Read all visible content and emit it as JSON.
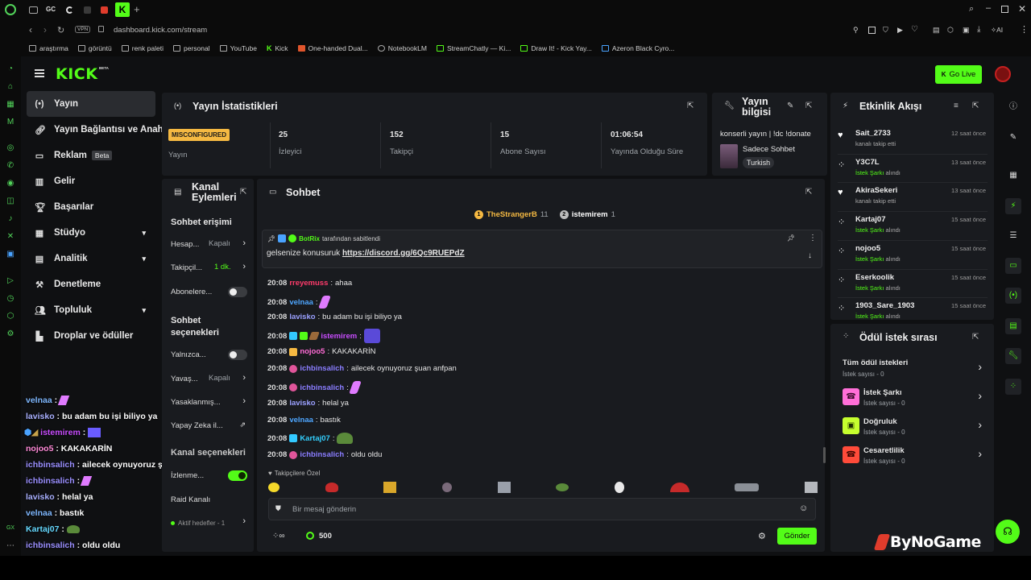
{
  "browser": {
    "tabs": [
      "GC"
    ],
    "url": "dashboard.kick.com/stream",
    "vpn": "VPN",
    "ai_label": "AI",
    "bookmarks": [
      "araştırma",
      "görüntü",
      "renk paleti",
      "personal",
      "YouTube",
      "Kick",
      "One-handed Dual...",
      "NotebookLM",
      "StreamChatly — Ki...",
      "Draw It! - Kick Yay...",
      "Azeron Black Cyro..."
    ]
  },
  "brand": {
    "logo": "KICK",
    "beta": "BETA",
    "accent": "#53fc18"
  },
  "header": {
    "go_live": "Go Live"
  },
  "sidebar": {
    "items": [
      {
        "label": "Yayın",
        "icon": "broadcast-icon"
      },
      {
        "label": "Yayın Bağlantısı ve Anahtar",
        "icon": "link-icon"
      },
      {
        "label": "Reklam",
        "badge": "Beta",
        "icon": "ad-icon"
      },
      {
        "label": "Gelir",
        "icon": "revenue-icon"
      },
      {
        "label": "Başarılar",
        "icon": "trophy-icon"
      },
      {
        "label": "Stüdyo",
        "icon": "studio-icon"
      },
      {
        "label": "Analitik",
        "icon": "chart-icon"
      },
      {
        "label": "Denetleme",
        "icon": "hammer-icon"
      },
      {
        "label": "Topluluk",
        "icon": "community-icon"
      },
      {
        "label": "Droplar ve ödüller",
        "icon": "drops-icon"
      }
    ]
  },
  "stats": {
    "title": "Yayın İstatistikleri",
    "status_badge": "MISCONFIGURED",
    "status_label": "Yayın",
    "cells": [
      {
        "value": "25",
        "label": "İzleyici"
      },
      {
        "value": "152",
        "label": "Takipçi"
      },
      {
        "value": "15",
        "label": "Abone Sayısı"
      },
      {
        "value": "01:06:54",
        "label": "Yayında Olduğu Süre"
      }
    ]
  },
  "stream_info": {
    "title": "Yayın bilgisi",
    "stream_title": "konserli yayın | !dc !donate",
    "category": "Sadece Sohbet",
    "language": "Turkish"
  },
  "channel_actions": {
    "title": "Kanal Eylemleri",
    "chat_access": "Sohbet erişimi",
    "rows1": [
      {
        "label": "Hesap...",
        "value": "Kapalı"
      },
      {
        "label": "Takipçil...",
        "value": "1 dk."
      },
      {
        "label": "Abonelere...",
        "value": ""
      }
    ],
    "chat_options": "Sohbet seçenekleri",
    "rows2": [
      {
        "label": "Yalnızca...",
        "value": ""
      },
      {
        "label": "Yavaş...",
        "value": "Kapalı"
      },
      {
        "label": "Yasaklanmış...",
        "value": ""
      },
      {
        "label": "Yapay Zeka il...",
        "value": ""
      }
    ],
    "channel_options": "Kanal seçenekleri",
    "rows3": [
      {
        "label": "İzlenme...",
        "value": ""
      },
      {
        "label": "Raid Kanalı",
        "value": ""
      },
      {
        "label": "Aktif hedefler - 1",
        "value": ""
      }
    ]
  },
  "chat": {
    "title": "Sohbet",
    "top_gifters": [
      {
        "name": "TheStrangerB",
        "count": "11"
      },
      {
        "name": "istemirem",
        "count": "1"
      }
    ],
    "pinned_by": "BotRix",
    "pinned_suffix": "tarafından sabitlendi",
    "pinned_text": "gelsenize konusuruk",
    "pinned_link": "https://discord.gg/6Qc9RUEPdZ",
    "messages": [
      {
        "time": "20:08",
        "user": "rreyemuss",
        "color": "#ff3b6b",
        "text": "ahaa"
      },
      {
        "time": "20:08",
        "user": "velnaa",
        "color": "#4ea6ff",
        "text": ""
      },
      {
        "time": "20:08",
        "user": "lavisko",
        "color": "#9aa0ff",
        "text": "bu adam bu işi biliyo ya"
      },
      {
        "time": "20:08",
        "user": "istemirem",
        "color": "#c94dff",
        "text": ""
      },
      {
        "time": "20:08",
        "user": "nojoo5",
        "color": "#ff6bd6",
        "text": "KAKAKARİN"
      },
      {
        "time": "20:08",
        "user": "ichbinsalich",
        "color": "#8a7dff",
        "text": "ailecek oynuyoruz şuan anfpan"
      },
      {
        "time": "20:08",
        "user": "ichbinsalich",
        "color": "#8a7dff",
        "text": ""
      },
      {
        "time": "20:08",
        "user": "lavisko",
        "color": "#9aa0ff",
        "text": "helal ya"
      },
      {
        "time": "20:08",
        "user": "velnaa",
        "color": "#4ea6ff",
        "text": "bastık"
      },
      {
        "time": "20:08",
        "user": "Kartaj07",
        "color": "#33d0ff",
        "text": ""
      },
      {
        "time": "20:08",
        "user": "ichbinsalich",
        "color": "#8a7dff",
        "text": "oldu oldu"
      }
    ],
    "followers_only": "Takipçilere Özel",
    "placeholder": "Bir mesaj gönderin",
    "points": "500",
    "send": "Gönder"
  },
  "activity": {
    "title": "Etkinlik Akışı",
    "events": [
      {
        "name": "Sait_2733",
        "sub": "kanalı takip etti",
        "time": "12 saat önce",
        "kind": "follow"
      },
      {
        "name": "Y3C7L",
        "sub": "İstek Şarkı alındı",
        "time": "13 saat önce",
        "kind": "reward"
      },
      {
        "name": "AkiraSekeri",
        "sub": "kanalı takip etti",
        "time": "13 saat önce",
        "kind": "follow"
      },
      {
        "name": "Kartaj07",
        "sub": "İstek Şarkı alındı",
        "time": "15 saat önce",
        "kind": "reward"
      },
      {
        "name": "nojoo5",
        "sub": "İstek Şarkı alındı",
        "time": "15 saat önce",
        "kind": "reward"
      },
      {
        "name": "Eserkoolik",
        "sub": "İstek Şarkı alındı",
        "time": "15 saat önce",
        "kind": "reward"
      },
      {
        "name": "1903_Sare_1903",
        "sub": "İstek Şarkı alındı",
        "time": "15 saat önce",
        "kind": "reward"
      }
    ]
  },
  "rewards": {
    "title": "Ödül istek sırası",
    "items": [
      {
        "name": "Tüm ödül istekleri",
        "sub": "İstek sayısı - 0",
        "color": ""
      },
      {
        "name": "İstek Şarkı",
        "sub": "İstek sayısı - 0",
        "color": "#ff6fd8"
      },
      {
        "name": "Doğruluk",
        "sub": "İstek sayısı - 0",
        "color": "#c6ff2e"
      },
      {
        "name": "Cesaretlilik",
        "sub": "İstek sayısı - 0",
        "color": "#ff4b3a"
      }
    ]
  },
  "overlay_chat": [
    {
      "user": "velnaa",
      "color": "#7fb8ff",
      "text": ""
    },
    {
      "user": "lavisko",
      "color": "#a9b0ff",
      "text": "bu adam bu işi biliyo ya"
    },
    {
      "user": "istemirem",
      "color": "#c94dff",
      "text": ""
    },
    {
      "user": "nojoo5",
      "color": "#ff8ad8",
      "text": "KAKAKARİN"
    },
    {
      "user": "ichbinsalich",
      "color": "#9a8fff",
      "text": "ailecek oynuyoruz şuan anfpan"
    },
    {
      "user": "ichbinsalich",
      "color": "#9a8fff",
      "text": ""
    },
    {
      "user": "lavisko",
      "color": "#a9b0ff",
      "text": "helal ya"
    },
    {
      "user": "velnaa",
      "color": "#7fb8ff",
      "text": "bastık"
    },
    {
      "user": "Kartaj07",
      "color": "#66d9ff",
      "text": ""
    },
    {
      "user": "ichbinsalich",
      "color": "#9a8fff",
      "text": "oldu oldu"
    }
  ],
  "watermark": "ByNoGame"
}
